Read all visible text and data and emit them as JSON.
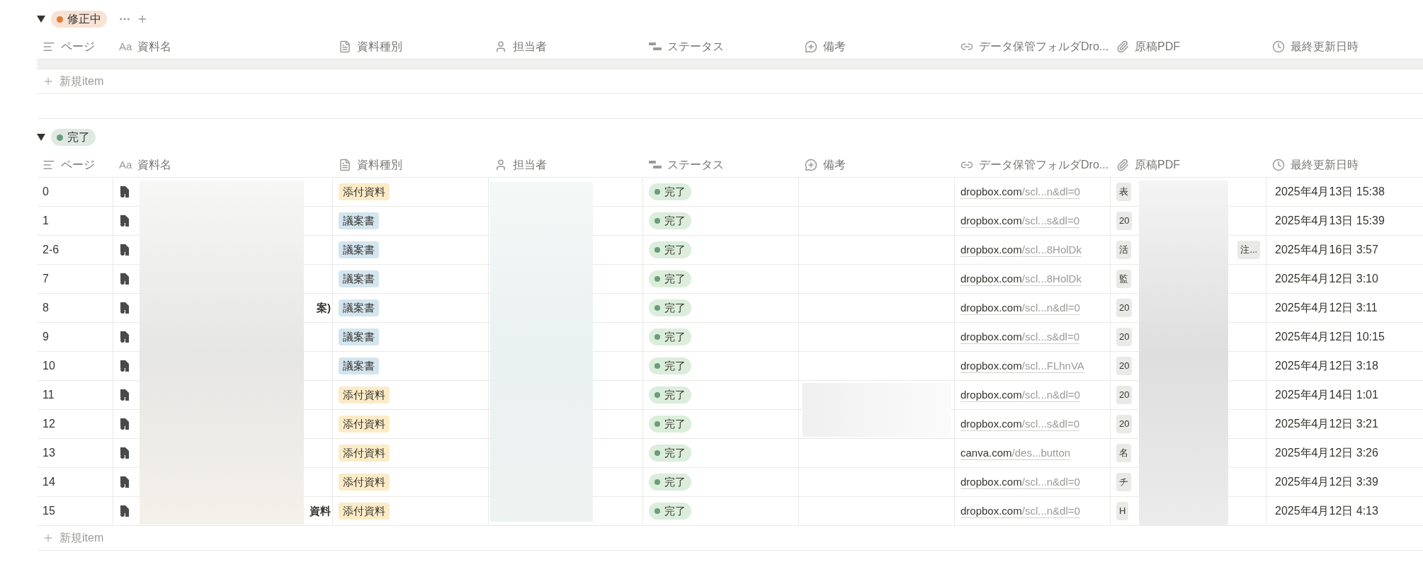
{
  "groups": [
    {
      "label": "修正中",
      "color": "#e07b39",
      "hovered": true,
      "columns": [
        {
          "kind": "text",
          "label": "ページ"
        },
        {
          "kind": "title",
          "label": "資料名",
          "glyph": "Aa"
        },
        {
          "kind": "select",
          "label": "資料種別"
        },
        {
          "kind": "person",
          "label": "担当者"
        },
        {
          "kind": "status",
          "label": "ステータス"
        },
        {
          "kind": "comment",
          "label": "備考"
        },
        {
          "kind": "url",
          "label": "データ保管フォルダDro..."
        },
        {
          "kind": "files",
          "label": "原稿PDF"
        },
        {
          "kind": "edited",
          "label": "最終更新日時"
        }
      ],
      "new_item": "新規item"
    },
    {
      "label": "完了",
      "color": "#6c9b7d",
      "hovered": false,
      "columns": [
        {
          "kind": "text",
          "label": "ページ"
        },
        {
          "kind": "title",
          "label": "資料名",
          "glyph": "Aa"
        },
        {
          "kind": "select",
          "label": "資料種別"
        },
        {
          "kind": "person",
          "label": "担当者"
        },
        {
          "kind": "status",
          "label": "ステータス"
        },
        {
          "kind": "comment",
          "label": "備考"
        },
        {
          "kind": "url",
          "label": "データ保管フォルダDro..."
        },
        {
          "kind": "files",
          "label": "原稿PDF"
        },
        {
          "kind": "edited",
          "label": "最終更新日時"
        }
      ],
      "rows": [
        {
          "page": "0",
          "kind": {
            "label": "添付資料",
            "color": "#fbecc7"
          },
          "status": {
            "label": "完了",
            "color": "#6c9b7d"
          },
          "link": {
            "host": "dropbox.com",
            "path": "/scl...n&dl=0"
          },
          "pdf": [
            "表"
          ],
          "date": "2025年4月13日 15:38"
        },
        {
          "page": "1",
          "kind": {
            "label": "議案書",
            "color": "#d3e5ef"
          },
          "status": {
            "label": "完了",
            "color": "#6c9b7d"
          },
          "link": {
            "host": "dropbox.com",
            "path": "/scl...s&dl=0"
          },
          "pdf": [
            "20"
          ],
          "date": "2025年4月13日 15:39"
        },
        {
          "page": "2-6",
          "kind": {
            "label": "議案書",
            "color": "#d3e5ef"
          },
          "status": {
            "label": "完了",
            "color": "#6c9b7d"
          },
          "link": {
            "host": "dropbox.com",
            "path": "/scl...8HolDk"
          },
          "pdf": [
            "活",
            "注..."
          ],
          "date": "2025年4月16日 3:57"
        },
        {
          "page": "7",
          "kind": {
            "label": "議案書",
            "color": "#d3e5ef"
          },
          "status": {
            "label": "完了",
            "color": "#6c9b7d"
          },
          "link": {
            "host": "dropbox.com",
            "path": "/scl...8HolDk"
          },
          "pdf": [
            "監"
          ],
          "date": "2025年4月12日 3:10"
        },
        {
          "page": "8",
          "name": "案)",
          "kind": {
            "label": "議案書",
            "color": "#d3e5ef"
          },
          "status": {
            "label": "完了",
            "color": "#6c9b7d"
          },
          "link": {
            "host": "dropbox.com",
            "path": "/scl...n&dl=0"
          },
          "pdf": [
            "20"
          ],
          "date": "2025年4月12日 3:11"
        },
        {
          "page": "9",
          "kind": {
            "label": "議案書",
            "color": "#d3e5ef"
          },
          "status": {
            "label": "完了",
            "color": "#6c9b7d"
          },
          "link": {
            "host": "dropbox.com",
            "path": "/scl...s&dl=0"
          },
          "pdf": [
            "20"
          ],
          "date": "2025年4月12日 10:15"
        },
        {
          "page": "10",
          "kind": {
            "label": "議案書",
            "color": "#d3e5ef"
          },
          "status": {
            "label": "完了",
            "color": "#6c9b7d"
          },
          "link": {
            "host": "dropbox.com",
            "path": "/scl...FLhnVA"
          },
          "pdf": [
            "20"
          ],
          "date": "2025年4月12日 3:18"
        },
        {
          "page": "11",
          "kind": {
            "label": "添付資料",
            "color": "#fbecc7"
          },
          "status": {
            "label": "完了",
            "color": "#6c9b7d"
          },
          "link": {
            "host": "dropbox.com",
            "path": "/scl...n&dl=0"
          },
          "pdf": [
            "20"
          ],
          "date": "2025年4月14日 1:01"
        },
        {
          "page": "12",
          "kind": {
            "label": "添付資料",
            "color": "#fbecc7"
          },
          "status": {
            "label": "完了",
            "color": "#6c9b7d"
          },
          "link": {
            "host": "dropbox.com",
            "path": "/scl...s&dl=0"
          },
          "pdf": [
            "20"
          ],
          "date": "2025年4月12日 3:21"
        },
        {
          "page": "13",
          "kind": {
            "label": "添付資料",
            "color": "#fbecc7"
          },
          "status": {
            "label": "完了",
            "color": "#6c9b7d"
          },
          "link": {
            "host": "canva.com",
            "path": "/des...button"
          },
          "pdf": [
            "名"
          ],
          "date": "2025年4月12日 3:26"
        },
        {
          "page": "14",
          "kind": {
            "label": "添付資料",
            "color": "#fbecc7"
          },
          "status": {
            "label": "完了",
            "color": "#6c9b7d"
          },
          "link": {
            "host": "dropbox.com",
            "path": "/scl...n&dl=0"
          },
          "pdf": [
            "チ"
          ],
          "date": "2025年4月12日 3:39"
        },
        {
          "page": "15",
          "name": "資料",
          "kind": {
            "label": "添付資料",
            "color": "#fbecc7"
          },
          "status": {
            "label": "完了",
            "color": "#6c9b7d"
          },
          "link": {
            "host": "dropbox.com",
            "path": "/scl...n&dl=0"
          },
          "pdf": [
            "H"
          ],
          "date": "2025年4月12日 4:13"
        }
      ],
      "new_item": "新規item"
    }
  ]
}
